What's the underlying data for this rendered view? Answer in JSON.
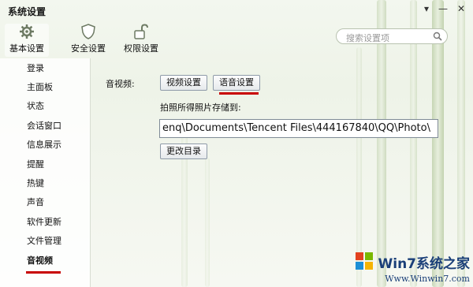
{
  "window": {
    "title": "系统设置",
    "controls": [
      "▾",
      "—",
      "✕"
    ]
  },
  "toolbar": {
    "items": [
      {
        "label": "基本设置",
        "icon": "gear-icon",
        "active": true
      },
      {
        "label": "安全设置",
        "icon": "shield-icon",
        "active": false
      },
      {
        "label": "权限设置",
        "icon": "unlock-icon",
        "active": false
      }
    ]
  },
  "search": {
    "placeholder": "搜索设置项"
  },
  "sidebar": {
    "items": [
      {
        "label": "登录"
      },
      {
        "label": "主面板"
      },
      {
        "label": "状态"
      },
      {
        "label": "会话窗口"
      },
      {
        "label": "信息展示"
      },
      {
        "label": "提醒"
      },
      {
        "label": "热键"
      },
      {
        "label": "声音"
      },
      {
        "label": "软件更新"
      },
      {
        "label": "文件管理"
      },
      {
        "label": "音视频"
      }
    ],
    "selected": "音视频"
  },
  "content": {
    "section_label": "音视频:",
    "video_button": "视频设置",
    "audio_button": "语音设置",
    "photo_label": "拍照所得照片存储到:",
    "photo_path": "enq\\Documents\\Tencent Files\\444167840\\QQ\\Photo\\",
    "change_dir_button": "更改目录"
  },
  "watermark": {
    "brand": "Win7系统之家",
    "url": "Www.Winwin7.com"
  },
  "colors": {
    "accent_red": "#c80000",
    "bg": "#eef3e8"
  }
}
